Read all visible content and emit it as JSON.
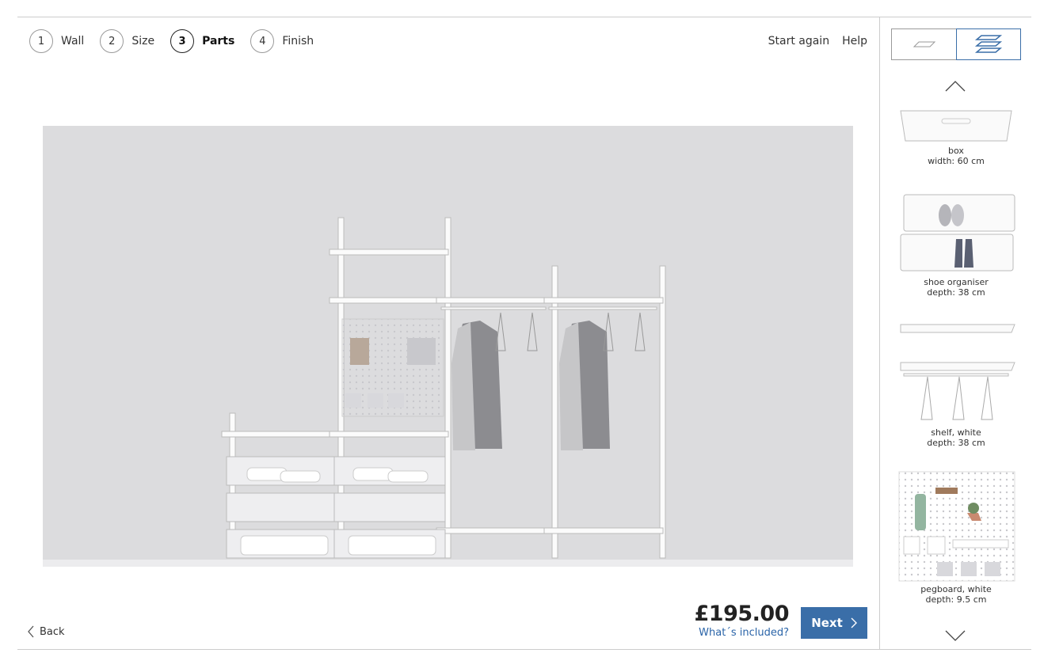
{
  "steps": [
    {
      "num": "1",
      "label": "Wall"
    },
    {
      "num": "2",
      "label": "Size"
    },
    {
      "num": "3",
      "label": "Parts"
    },
    {
      "num": "4",
      "label": "Finish"
    }
  ],
  "header": {
    "start_again": "Start again",
    "help": "Help"
  },
  "footer": {
    "back": "Back",
    "price": "£195.00",
    "whats_included": "What´s included?",
    "next": "Next"
  },
  "sidebar": {
    "parts": [
      {
        "name": "box",
        "detail": "width: 60 cm"
      },
      {
        "name": "shoe organiser",
        "detail": "depth: 38 cm"
      },
      {
        "name": "shelf, white",
        "detail": "depth: 38 cm"
      },
      {
        "name": "pegboard, white",
        "detail": "depth: 9.5 cm"
      }
    ]
  },
  "colors": {
    "accent": "#3a6ea8",
    "wall": "#dcdcde",
    "link": "#2a64a8"
  }
}
